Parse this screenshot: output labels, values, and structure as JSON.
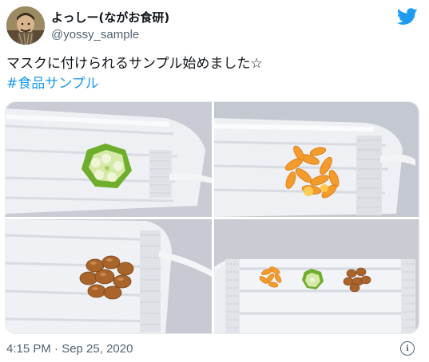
{
  "author": {
    "display_name": "よっしー(ながお食研)",
    "handle": "@yossy_sample",
    "avatar_icon": "user-avatar-photo"
  },
  "brand": {
    "icon": "twitter-bird-icon",
    "color": "#1d9bf0"
  },
  "tweet": {
    "text": "マスクに付けられるサンプル始めました☆",
    "hashtag": "#食品サンプル"
  },
  "media": {
    "photos": [
      {
        "subject": "okra-slice-on-mask"
      },
      {
        "subject": "salmon-roe-on-mask"
      },
      {
        "subject": "natto-beans-on-mask"
      },
      {
        "subject": "three-samples-on-mask"
      }
    ]
  },
  "footer": {
    "timestamp": "4:15 PM · Sep 25, 2020",
    "info_icon": "info-icon",
    "info_symbol": "i"
  }
}
